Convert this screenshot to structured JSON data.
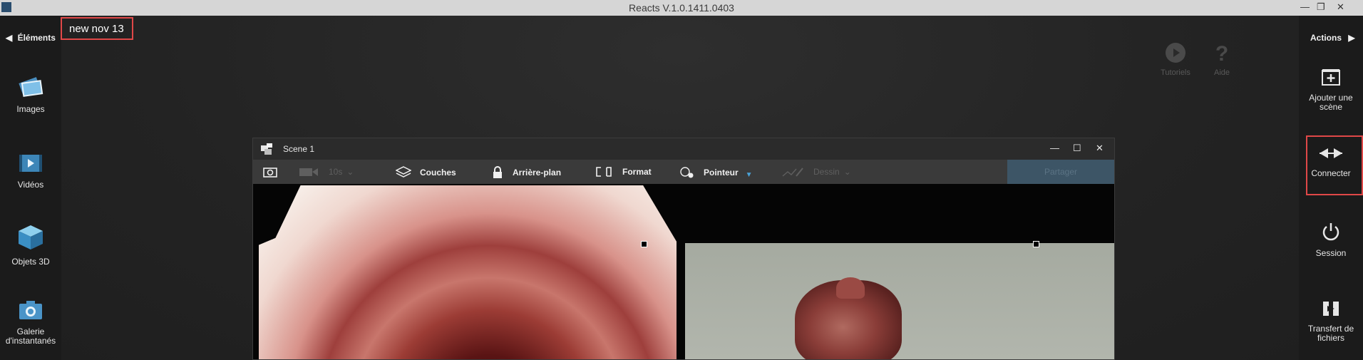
{
  "app": {
    "title": "Reacts V.1.0.1411.0403"
  },
  "window_controls": {
    "minimize": "—",
    "restore": "❐",
    "close": "✕"
  },
  "left_panel": {
    "header": "Éléments",
    "items": [
      {
        "label": "Images",
        "icon": "images-icon"
      },
      {
        "label": "Vidéos",
        "icon": "videos-icon"
      },
      {
        "label": "Objets 3D",
        "icon": "cube-icon"
      },
      {
        "label": "Galerie d'instantanés",
        "icon": "camera-icon"
      }
    ]
  },
  "document": {
    "name": "new nov 13"
  },
  "top_actions": {
    "tutorials": "Tutoriels",
    "help": "Aide"
  },
  "right_panel": {
    "header": "Actions",
    "items": [
      {
        "label": "Ajouter une scène",
        "icon": "add-scene-icon"
      },
      {
        "label": "Connecter",
        "icon": "connect-icon"
      },
      {
        "label": "Session",
        "icon": "power-icon"
      },
      {
        "label": "Transfert de fichiers",
        "icon": "file-transfer-icon"
      }
    ]
  },
  "scene": {
    "title": "Scene 1",
    "toolbar": {
      "duration": "10s",
      "layers": "Couches",
      "background": "Arrière-plan",
      "format": "Format",
      "pointer": "Pointeur",
      "drawing": "Dessin",
      "share": "Partager"
    }
  },
  "colors": {
    "accent_red": "#e04848",
    "share_blue": "#3d5566",
    "pointer_caret": "#4aa3d8"
  }
}
